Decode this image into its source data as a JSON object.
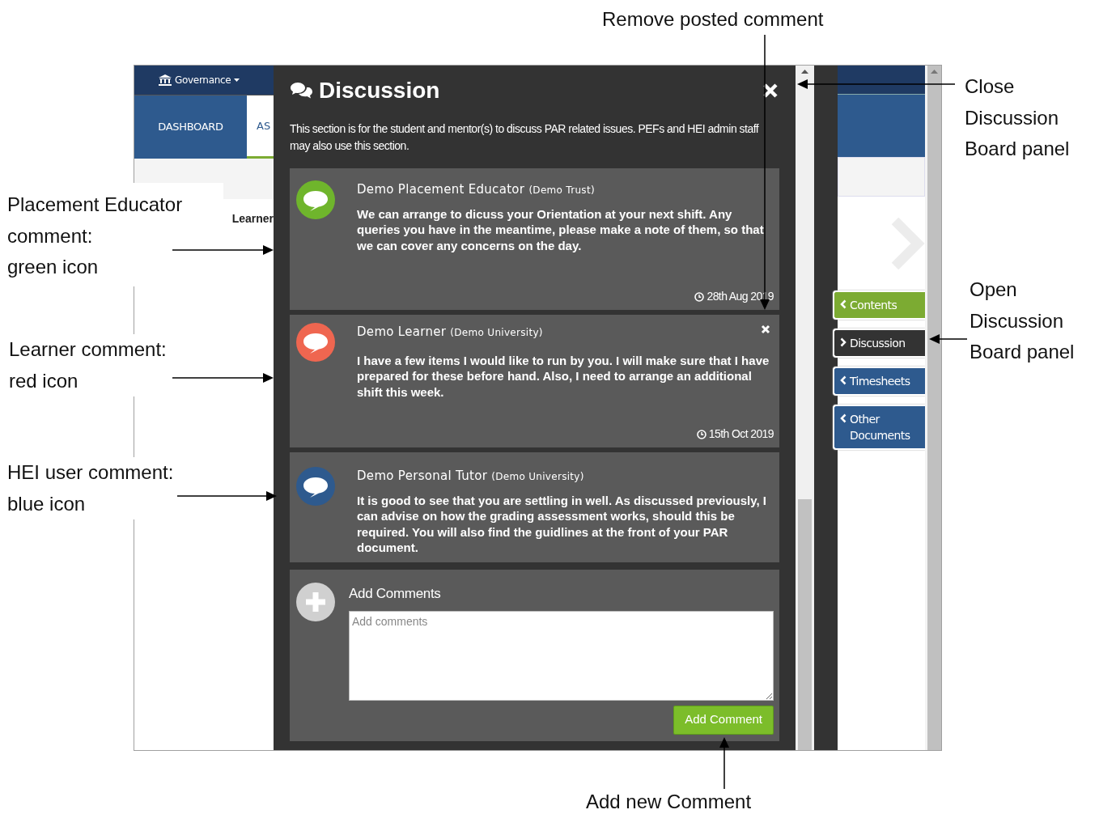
{
  "app_background": {
    "nav_menu": "Governance",
    "dashboard_tab": "DASHBOARD",
    "second_tab": "AS",
    "learner_label": "Learner"
  },
  "discussion_panel": {
    "title": "Discussion",
    "intro": "This section is for the student and mentor(s) to discuss PAR related issues. PEFs and HEI admin staff may also use this section.",
    "comments": [
      {
        "author": "Demo Placement Educator",
        "organisation": "(Demo Trust)",
        "text": "We can arrange to dicuss your Orientation at your next shift. Any queries you have in the meantime, please make a note of them, so that we can cover any concerns on the day.",
        "date": "28th Aug 2019",
        "color": "#6fb52c",
        "removable": false
      },
      {
        "author": "Demo Learner",
        "organisation": "(Demo University)",
        "text": "I have a few items I would like to run by you. I will make sure that I have prepared for these before hand. Also, I need to arrange an additional shift this week.",
        "date": "15th Oct 2019",
        "color": "#ef6650",
        "removable": true
      },
      {
        "author": "Demo Personal Tutor",
        "organisation": "(Demo University)",
        "text": "It is good to see that you are settling in well. As discussed previously, I can advise on how the grading assessment works, should this be required. You will also find the guidlines at the front of your PAR document.",
        "color": "#2e5a8e",
        "removable": false
      }
    ],
    "add_comments": {
      "label": "Add Comments",
      "placeholder": "Add comments",
      "button": "Add Comment"
    }
  },
  "side_tabs": [
    {
      "label": "Contents",
      "color": "#7cab32",
      "open": false
    },
    {
      "label": "Discussion",
      "color": "#333333",
      "open": true
    },
    {
      "label": "Timesheets",
      "color": "#2e5a8e",
      "open": false
    },
    {
      "label": "Other Documents",
      "color": "#2e5a8e",
      "open": false
    }
  ],
  "annotations": {
    "remove": [
      "Remove posted comment"
    ],
    "close": [
      "Close",
      "Discussion",
      "Board panel"
    ],
    "open": [
      "Open",
      "Discussion",
      "Board panel"
    ],
    "educator": [
      "Placement Educator",
      "comment:",
      "green icon"
    ],
    "learner": [
      "Learner comment:",
      "red icon"
    ],
    "hei": [
      "HEI user comment:",
      "blue icon"
    ],
    "add": [
      "Add new Comment"
    ]
  }
}
